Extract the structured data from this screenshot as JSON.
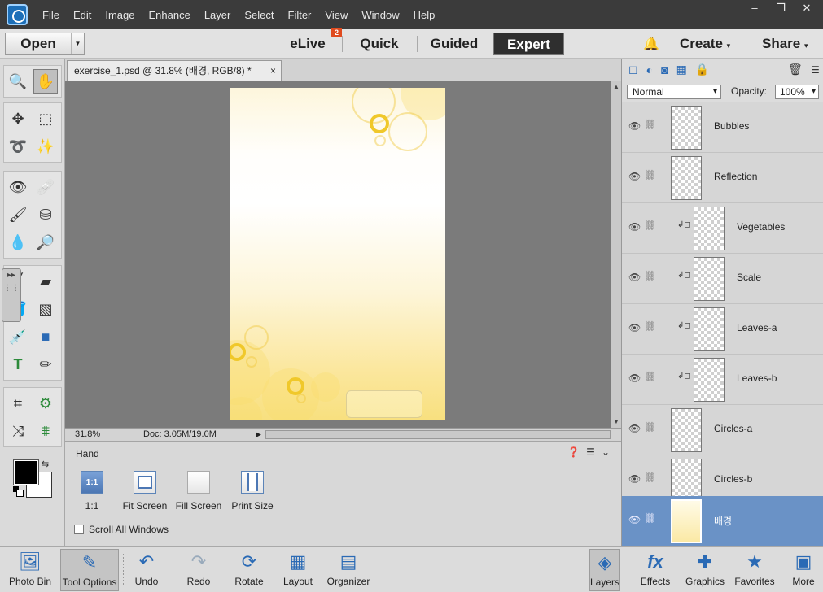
{
  "menubar": {
    "items": [
      "File",
      "Edit",
      "Image",
      "Enhance",
      "Layer",
      "Select",
      "Filter",
      "View",
      "Window",
      "Help"
    ],
    "window_controls": [
      "–",
      "❐",
      "✕"
    ]
  },
  "modebar": {
    "open_label": "Open",
    "elive_label": "eLive",
    "elive_badge": "2",
    "quick_label": "Quick",
    "guided_label": "Guided",
    "expert_label": "Expert",
    "active_mode": "Expert",
    "create_label": "Create",
    "share_label": "Share"
  },
  "document": {
    "tab_title": "exercise_1.psd @ 31.8% (배경, RGB/8) *",
    "close_glyph": "×",
    "zoom": "31.8%",
    "doc_info": "Doc: 3.05M/19.0M"
  },
  "tool_options": {
    "title": "Hand",
    "buttons": [
      "1:1",
      "Fit Screen",
      "Fill Screen",
      "Print Size"
    ],
    "icon_1to1": "1:1",
    "scroll_all_label": "Scroll All Windows",
    "scroll_all_checked": false
  },
  "layers_panel": {
    "blend_mode": "Normal",
    "opacity_label": "Opacity:",
    "opacity_value": "100%",
    "layers": [
      {
        "name": "Bubbles",
        "clipped": false,
        "selected": false
      },
      {
        "name": "Reflection",
        "clipped": false,
        "selected": false
      },
      {
        "name": "Vegetables",
        "clipped": true,
        "selected": false
      },
      {
        "name": "Scale",
        "clipped": true,
        "selected": false
      },
      {
        "name": "Leaves-a",
        "clipped": true,
        "selected": false
      },
      {
        "name": "Leaves-b",
        "clipped": true,
        "selected": false
      },
      {
        "name": "Circles-a",
        "clipped": false,
        "selected": false
      },
      {
        "name": "Circles-b",
        "clipped": false,
        "selected": false
      },
      {
        "name": "배경",
        "clipped": false,
        "selected": true
      }
    ]
  },
  "bottombar": {
    "photo_bin": "Photo Bin",
    "tool_options": "Tool Options",
    "undo": "Undo",
    "redo": "Redo",
    "rotate": "Rotate",
    "layout": "Layout",
    "organizer": "Organizer",
    "layers": "Layers",
    "effects": "Effects",
    "graphics": "Graphics",
    "favorites": "Favorites",
    "more": "More"
  },
  "colors": {
    "accent": "#2a6ab5",
    "selected_layer": "#6a92c6",
    "menubar": "#3b3b3b",
    "foreground": "#000000",
    "background": "#ffffff"
  }
}
